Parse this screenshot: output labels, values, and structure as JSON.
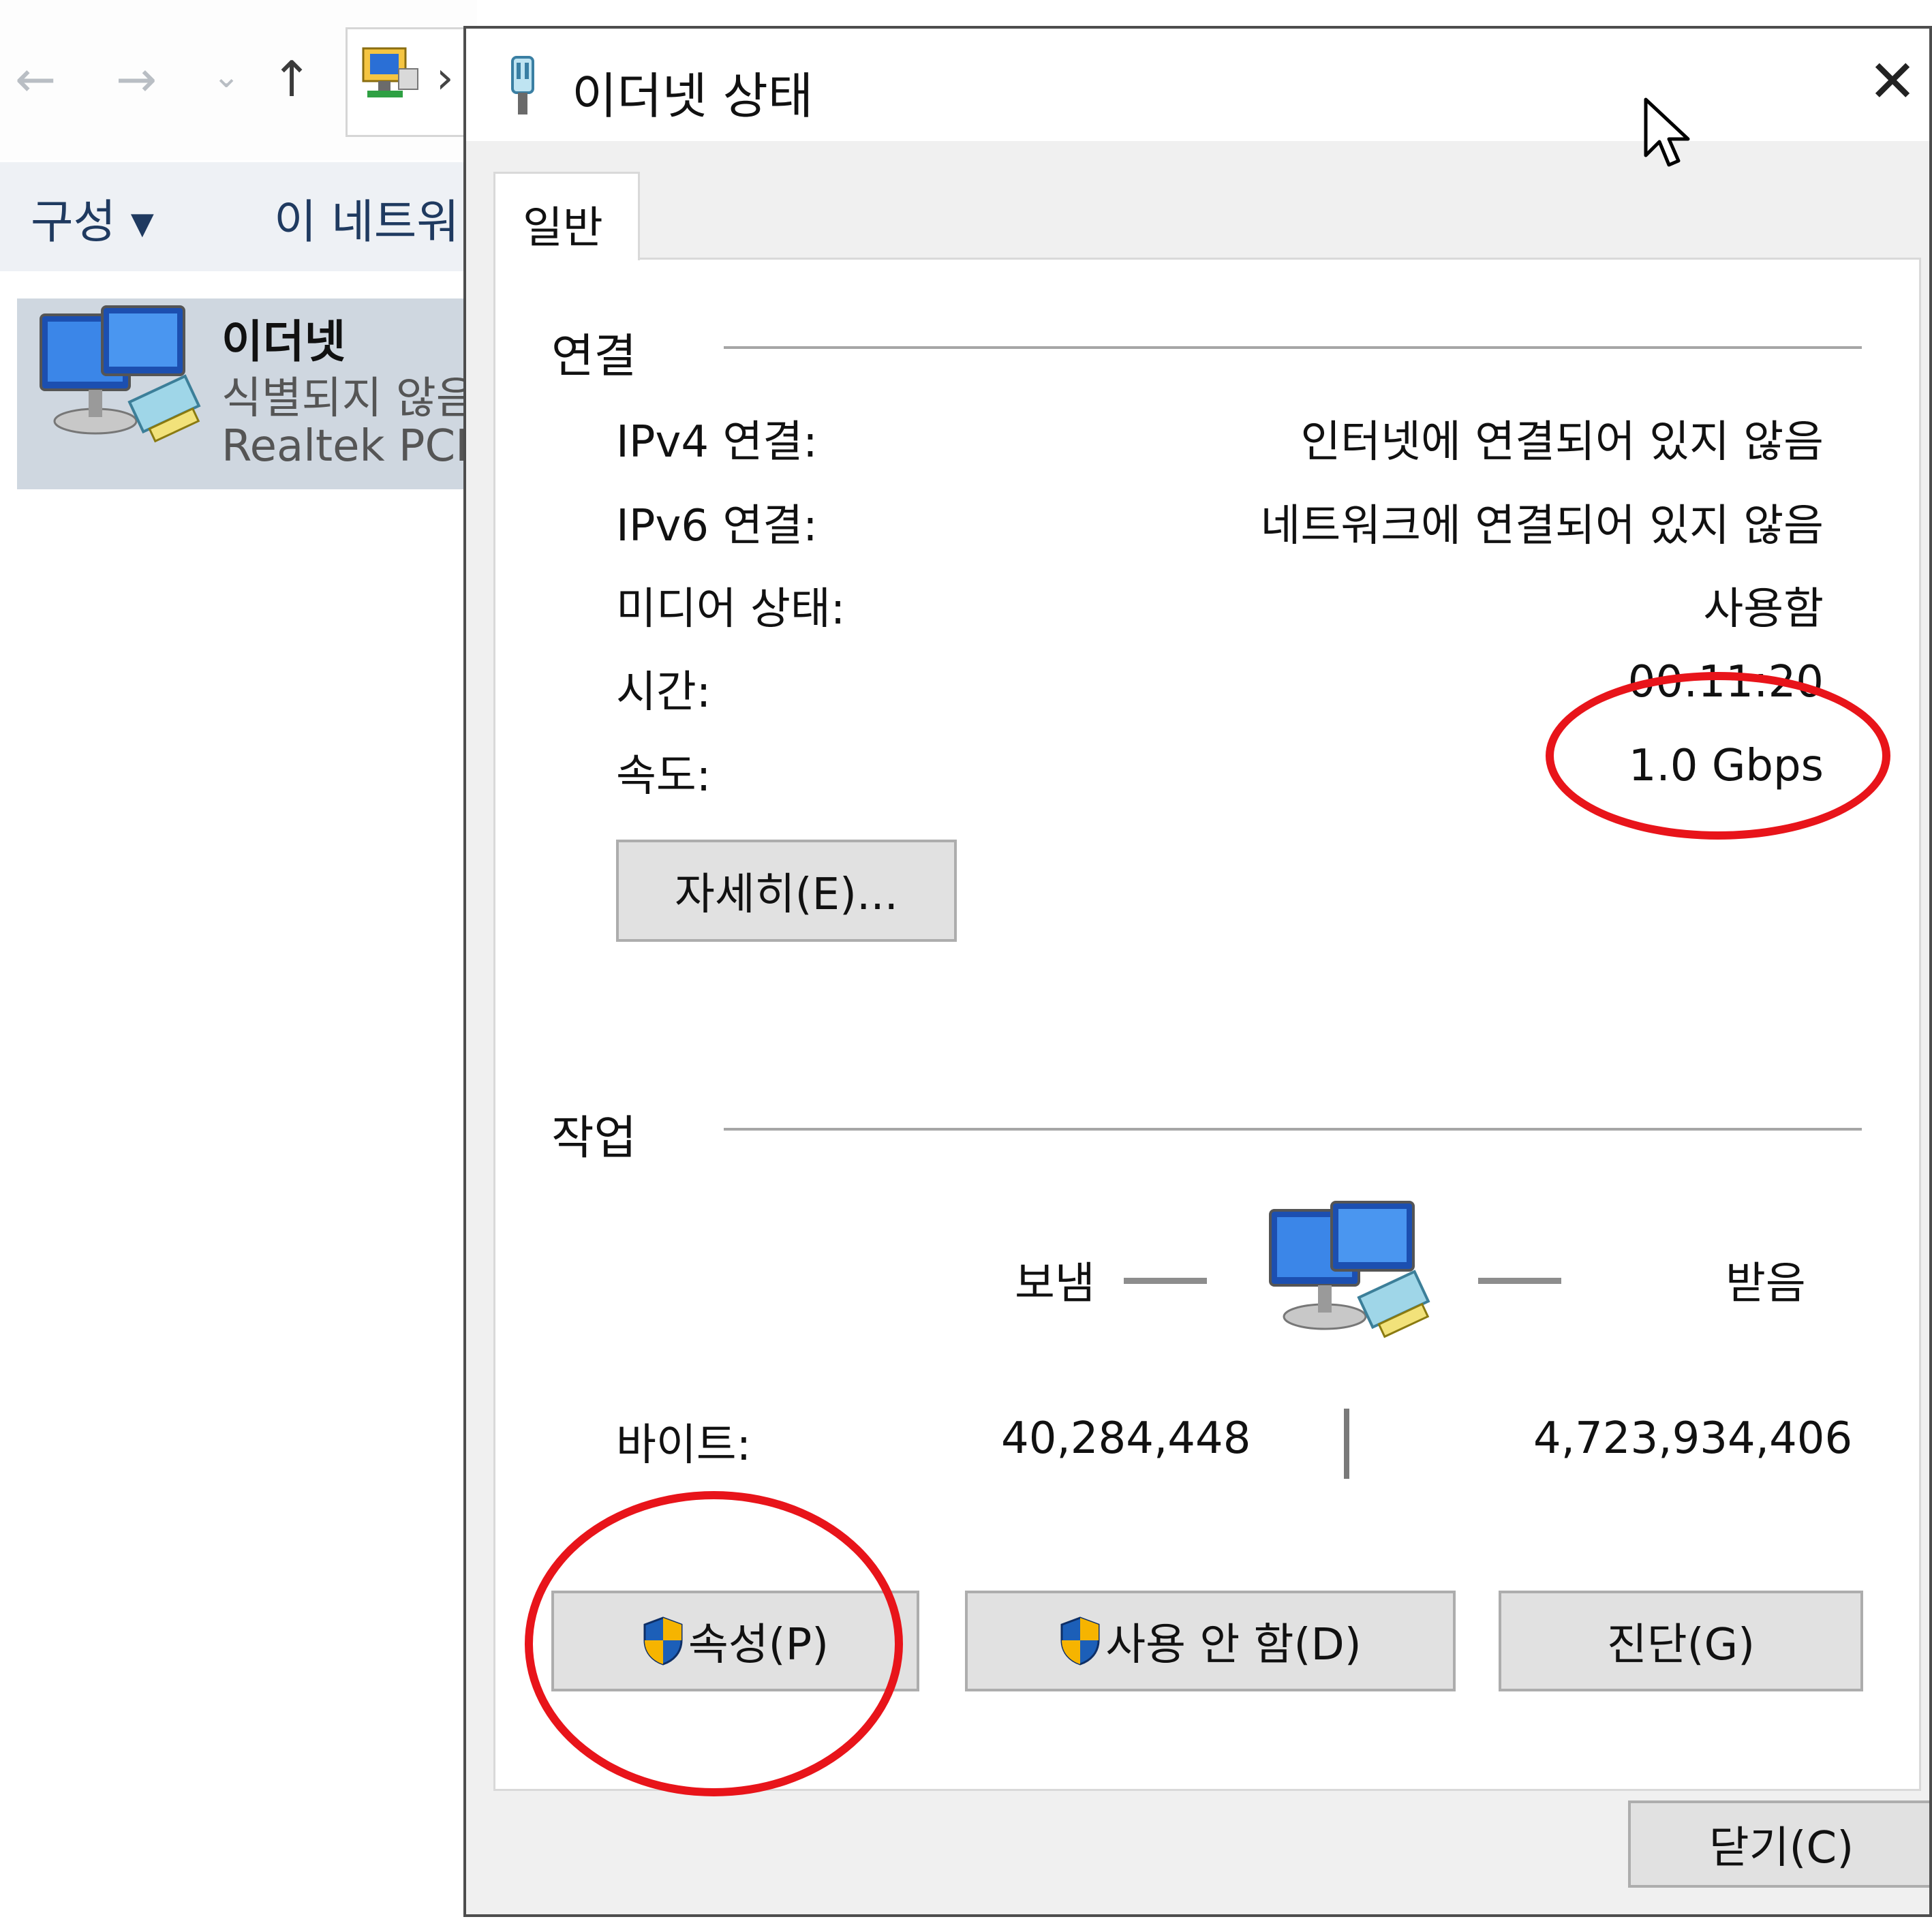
{
  "explorer": {
    "command_organize": "구성 ▾",
    "command_network": "이 네트워",
    "item": {
      "name": "이더넷",
      "status": "식별되지 않음",
      "adapter": "Realtek PCIe"
    }
  },
  "dialog": {
    "title": "이더넷 상태",
    "close_icon": "close-icon",
    "tab": "일반",
    "connection": {
      "title": "연결",
      "rows": [
        {
          "label": "IPv4 연결:",
          "value": "인터넷에 연결되어 있지 않음"
        },
        {
          "label": "IPv6 연결:",
          "value": "네트워크에 연결되어 있지 않음"
        },
        {
          "label": "미디어 상태:",
          "value": "사용함"
        },
        {
          "label": "시간:",
          "value": "00:11:20"
        },
        {
          "label": "속도:",
          "value": "1.0 Gbps"
        }
      ],
      "details_button": "자세히(E)..."
    },
    "activity": {
      "title": "작업",
      "sent_label": "보냄",
      "received_label": "받음",
      "bytes_label": "바이트:",
      "bytes_sent": "40,284,448",
      "bytes_received": "4,723,934,406"
    },
    "buttons": {
      "properties": "속성(P)",
      "disable": "사용 안 함(D)",
      "diagnose": "진단(G)",
      "close": "닫기(C)"
    }
  },
  "colors": {
    "annotation_red": "#e8141a",
    "shield_blue": "#1c5fb8",
    "shield_yellow": "#f6b400"
  }
}
